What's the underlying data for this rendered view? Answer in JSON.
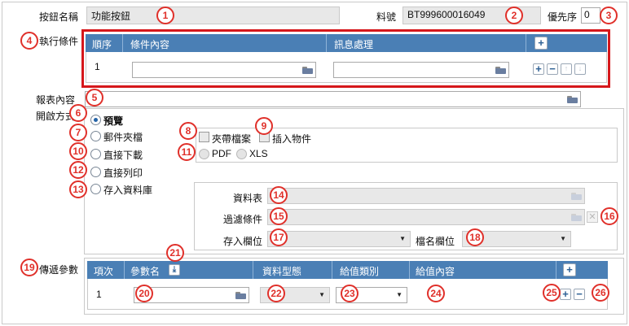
{
  "form": {
    "button_name_label": "按鈕名稱",
    "button_name_value": "功能按鈕",
    "item_no_label": "料號",
    "item_no_value": "BT999600016049",
    "priority_label": "優先序",
    "priority_value": "0",
    "exec_condition_label": "執行條件",
    "report_content_label": "報表內容",
    "open_mode_label": "開啟方式",
    "pass_params_label": "傳遞參數"
  },
  "condition_table": {
    "headers": [
      "順序",
      "條件內容",
      "訊息處理"
    ],
    "rows": [
      {
        "order": "1",
        "condition": "",
        "message": ""
      }
    ]
  },
  "open_modes": [
    {
      "label": "預覽",
      "selected": true
    },
    {
      "label": "郵件夾檔",
      "selected": false
    },
    {
      "label": "直接下載",
      "selected": false
    },
    {
      "label": "直接列印",
      "selected": false
    },
    {
      "label": "存入資料庫",
      "selected": false
    }
  ],
  "attachment": {
    "attach_file_label": "夾帶檔案",
    "insert_object_label": "插入物件",
    "pdf_label": "PDF",
    "xls_label": "XLS"
  },
  "database": {
    "table_label": "資料表",
    "filter_label": "過濾條件",
    "store_column_label": "存入欄位",
    "filename_column_label": "檔名欄位"
  },
  "param_table": {
    "headers": [
      "項次",
      "參數名",
      "資料型態",
      "給值類別",
      "給值內容"
    ],
    "rows": [
      {
        "item": "1",
        "name": "",
        "type": "",
        "value_class": "",
        "value": ""
      }
    ]
  },
  "callouts": [
    "1",
    "2",
    "3",
    "4",
    "5",
    "6",
    "7",
    "8",
    "9",
    "10",
    "11",
    "12",
    "13",
    "14",
    "15",
    "16",
    "17",
    "18",
    "19",
    "20",
    "21",
    "22",
    "23",
    "24",
    "25",
    "26"
  ],
  "colors": {
    "header_blue": "#4a7fb5",
    "callout_red": "#e0302a",
    "highlight_red": "#d6171b"
  }
}
